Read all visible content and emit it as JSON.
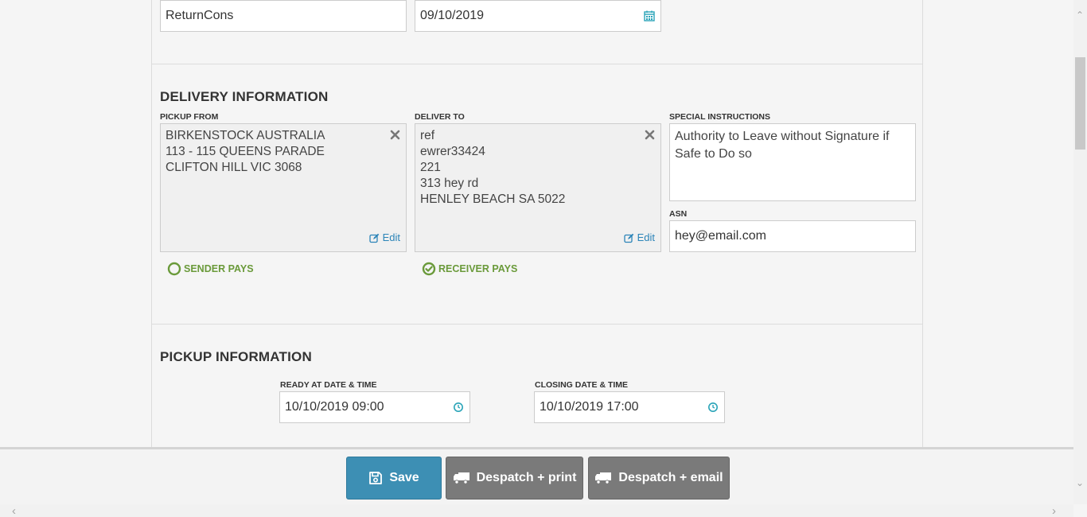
{
  "top_fields": {
    "reference_value": "ReturnCons",
    "date_value": "09/10/2019"
  },
  "delivery": {
    "title": "DELIVERY INFORMATION",
    "pickup_from": {
      "label": "PICKUP FROM",
      "lines": [
        "BIRKENSTOCK AUSTRALIA",
        "113 - 115 QUEENS PARADE",
        "CLIFTON HILL VIC 3068"
      ],
      "edit_label": "Edit"
    },
    "deliver_to": {
      "label": "DELIVER TO",
      "lines": [
        "ref",
        "ewrer33424",
        "221",
        "313 hey rd",
        "HENLEY BEACH SA 5022"
      ],
      "edit_label": "Edit"
    },
    "special_instructions": {
      "label": "SPECIAL INSTRUCTIONS",
      "value": "Authority to Leave without Signature if Safe to Do so"
    },
    "asn": {
      "label": "ASN",
      "value": "hey@email.com"
    },
    "sender_pays_label": "SENDER PAYS",
    "receiver_pays_label": "RECEIVER PAYS",
    "selected_payer": "receiver"
  },
  "pickup": {
    "title": "PICKUP INFORMATION",
    "ready_label": "READY AT DATE & TIME",
    "ready_value": "10/10/2019 09:00",
    "closing_label": "CLOSING DATE & TIME",
    "closing_value": "10/10/2019 17:00"
  },
  "footer": {
    "save_label": "Save",
    "despatch_print_label": "Despatch + print",
    "despatch_email_label": "Despatch + email"
  },
  "colors": {
    "accent": "#2b84b8",
    "primary_button": "#3d8fb4",
    "secondary_button": "#7a7a7a",
    "pay_green": "#6a9a3a"
  }
}
